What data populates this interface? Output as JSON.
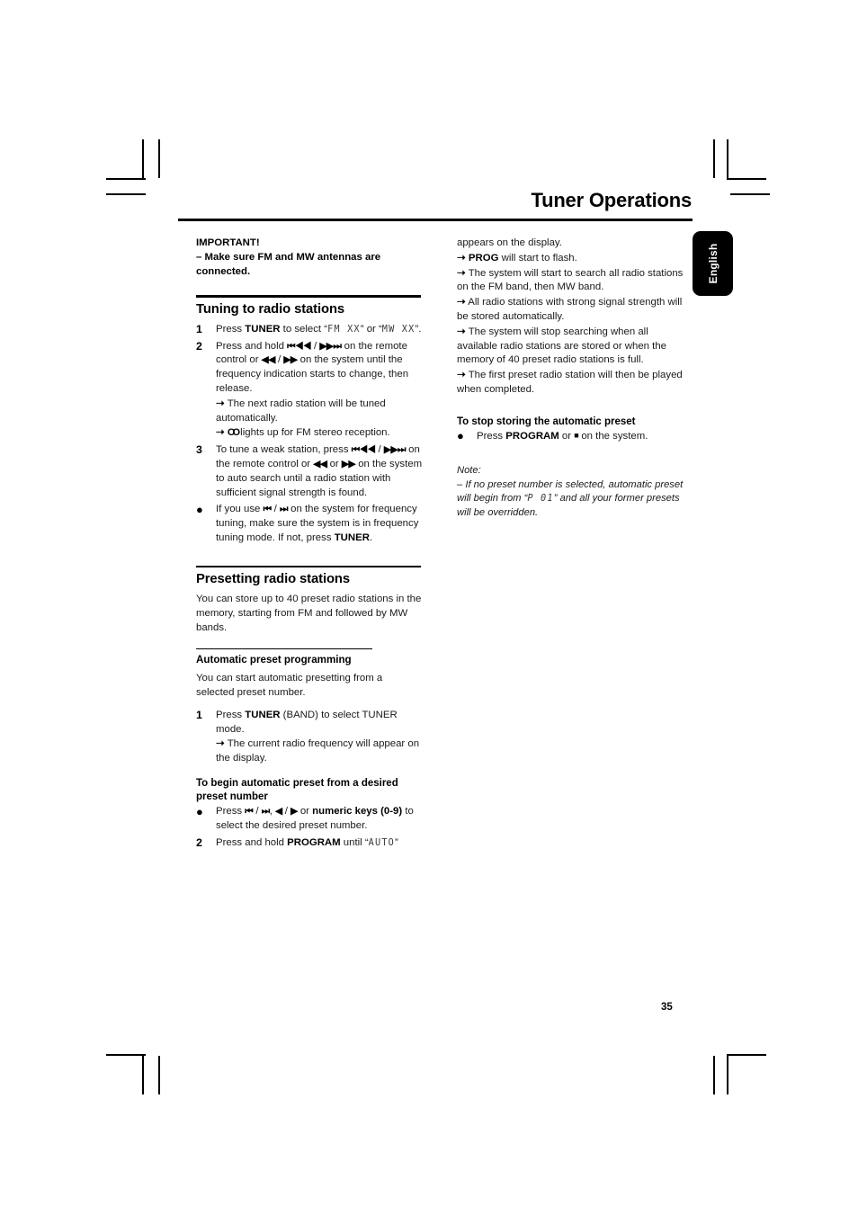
{
  "document": {
    "chapter_title": "Tuner Operations",
    "language_tab": "English",
    "page_number": "35"
  },
  "left_column": {
    "important": {
      "heading": "IMPORTANT!",
      "line": "–  Make sure FM and MW antennas are connected."
    },
    "tuning_section": {
      "heading": "Tuning to radio stations",
      "steps": [
        {
          "marker": "1",
          "text_before": "Press ",
          "bold": "TUNER",
          "text_after": " to select “",
          "lcd_1": "FM  XX",
          "between": "” or “",
          "lcd_2": "MW  XX",
          "tail": "”."
        },
        {
          "marker": "2",
          "line1_a": "Press and hold ",
          "glyph1": "⏮◀◀",
          "line1_b": " / ",
          "glyph2": "▶▶⏭",
          "line1_c": " on the remote control or ",
          "glyph3": "◀◀",
          "line1_d": " / ",
          "glyph4": "▶▶",
          "line1_e": " on the system until the frequency indication starts to change, then release.",
          "result_1": "The next radio station will be tuned automatically.",
          "result_2_stereo": "∞",
          "result_2": " lights up for FM stereo reception."
        },
        {
          "marker": "3",
          "a": "To tune a weak station, press ",
          "g1": "⏮◀◀",
          "b": " / ",
          "g2": "▶▶⏭",
          "c": " on the remote control or ",
          "g3": "◀◀",
          "d": " or ",
          "g4": "▶▶",
          "e": " on the system to auto search until a radio station with sufficient signal strength is found."
        },
        {
          "marker": "●",
          "a": "If you use ",
          "g1": "⏮",
          "b": " / ",
          "g2": "⏭",
          "c": " on the system for frequency tuning, make sure the system is in frequency tuning mode. If not, press ",
          "bold": "TUNER",
          "d": "."
        }
      ]
    },
    "presetting_section": {
      "heading": "Presetting radio stations",
      "intro": "You can store up to 40 preset radio stations in the memory, starting from FM and followed by MW bands.",
      "sub_heading": "Automatic preset programming",
      "sub_intro": "You can start automatic presetting from a selected preset number.",
      "step_1": {
        "marker": "1",
        "a": "Press ",
        "bold": "TUNER",
        "b": " (BAND) to select TUNER mode.",
        "result": "The current radio frequency will appear on the display."
      },
      "desired_preset": {
        "heading": "To begin automatic preset from a desired preset number",
        "marker": "●",
        "a": "Press ",
        "g1": "⏮",
        "b": " / ",
        "g2": "⏭",
        "c": ", ",
        "g3": "◀",
        "d": " / ",
        "g4": "▶",
        "e": " or ",
        "bold": "numeric keys (0-9)",
        "f": " to select the desired preset number."
      },
      "step_2": {
        "marker": "2",
        "a": "Press and hold ",
        "bold": "PROGRAM",
        "b": " until “",
        "lcd": "AUTO",
        "c": "”"
      }
    }
  },
  "right_column": {
    "continuation": "appears on the display.",
    "results": [
      {
        "bold": "PROG",
        "text": " will start to flash."
      },
      {
        "bold": "",
        "text": "The system will start to search all radio stations on the FM band, then MW band."
      },
      {
        "bold": "",
        "text": "All radio stations with strong signal strength will be stored automatically."
      },
      {
        "bold": "",
        "text": "The system will stop searching when all available radio stations are stored or when the memory of 40 preset radio stations is full."
      },
      {
        "bold": "",
        "text": "The first preset radio station will then be played when completed."
      }
    ],
    "stop_storing": {
      "heading": "To stop storing the automatic preset",
      "marker": "●",
      "a": "Press ",
      "bold": "PROGRAM",
      "b": " or ",
      "square": "■",
      "c": " on the system."
    },
    "note": {
      "label": "Note:",
      "a": "–  If no preset number is selected,  automatic preset will begin from “",
      "lcd": "P 01",
      "b": "” and all your former presets will be overridden."
    }
  }
}
